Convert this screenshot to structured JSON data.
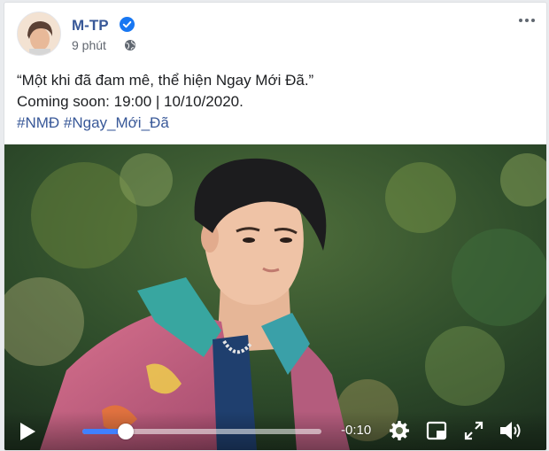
{
  "post": {
    "author": "M-TP",
    "time": "9 phút",
    "caption_line1": "“Một khi đã đam mê, thể hiện Ngay Mới Đã.”",
    "caption_line2": "Coming soon: 19:00 | 10/10/2020.",
    "hashtags": [
      "#NMĐ",
      "#Ngay_Mới_Đã"
    ]
  },
  "video": {
    "progress": 0.18,
    "time_remaining": "-0:10"
  },
  "colors": {
    "link_blue": "#385898",
    "verified_blue": "#1877f2",
    "progress_blue": "#4080ff"
  },
  "icons": [
    "verified-badge-icon",
    "globe-icon",
    "more-options-icon",
    "play-icon",
    "settings-gear-icon",
    "picture-in-picture-icon",
    "fullscreen-icon",
    "volume-icon"
  ]
}
